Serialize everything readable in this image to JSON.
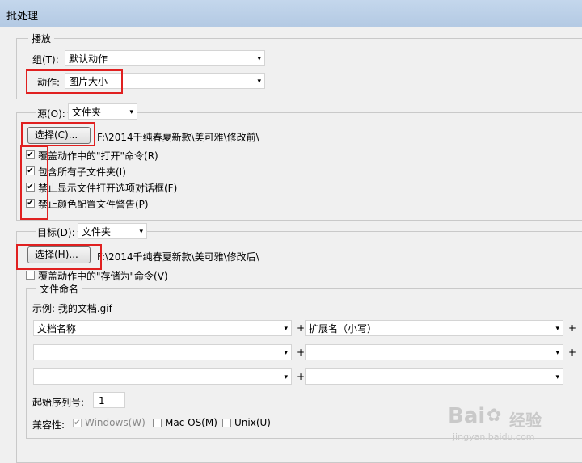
{
  "window": {
    "title": "批处理"
  },
  "play": {
    "legend": "播放",
    "group_label": "组(T):",
    "group_value": "默认动作",
    "action_label": "动作:",
    "action_value": "图片大小"
  },
  "source": {
    "label": "源(O):",
    "value": "文件夹",
    "choose_button": "选择(C)...",
    "path": "F:\\2014千纯春夏新款\\美可雅\\修改前\\",
    "options": [
      {
        "label": "覆盖动作中的\"打开\"命令(R)",
        "checked": true
      },
      {
        "label": "包含所有子文件夹(I)",
        "checked": true
      },
      {
        "label": "禁止显示文件打开选项对话框(F)",
        "checked": true
      },
      {
        "label": "禁止颜色配置文件警告(P)",
        "checked": true
      }
    ]
  },
  "destination": {
    "label": "目标(D):",
    "value": "文件夹",
    "choose_button": "选择(H)...",
    "path": "F:\\2014千纯春夏新款\\美可雅\\修改后\\",
    "override_save": {
      "label": "覆盖动作中的\"存储为\"命令(V)",
      "checked": false
    },
    "naming": {
      "legend": "文件命名",
      "example": "示例: 我的文档.gif",
      "fields": [
        "文档名称",
        "扩展名（小写）",
        "",
        "",
        "",
        ""
      ],
      "plus": "+",
      "serial_label": "起始序列号:",
      "serial_value": "1",
      "compat_label": "兼容性:",
      "compat": [
        {
          "label": "Windows(W)",
          "checked": true,
          "disabled": true
        },
        {
          "label": "Mac OS(M)",
          "checked": false,
          "disabled": false
        },
        {
          "label": "Unix(U)",
          "checked": false,
          "disabled": false
        }
      ]
    }
  },
  "icons": {
    "dropdown": "▾",
    "check": "✔"
  },
  "colors": {
    "highlight_box": "#e02020",
    "titlebar": "#c4d7ec"
  },
  "watermark": {
    "brand": "Bai",
    "brand_cn": "经验",
    "url": "jingyan.baidu.com"
  }
}
